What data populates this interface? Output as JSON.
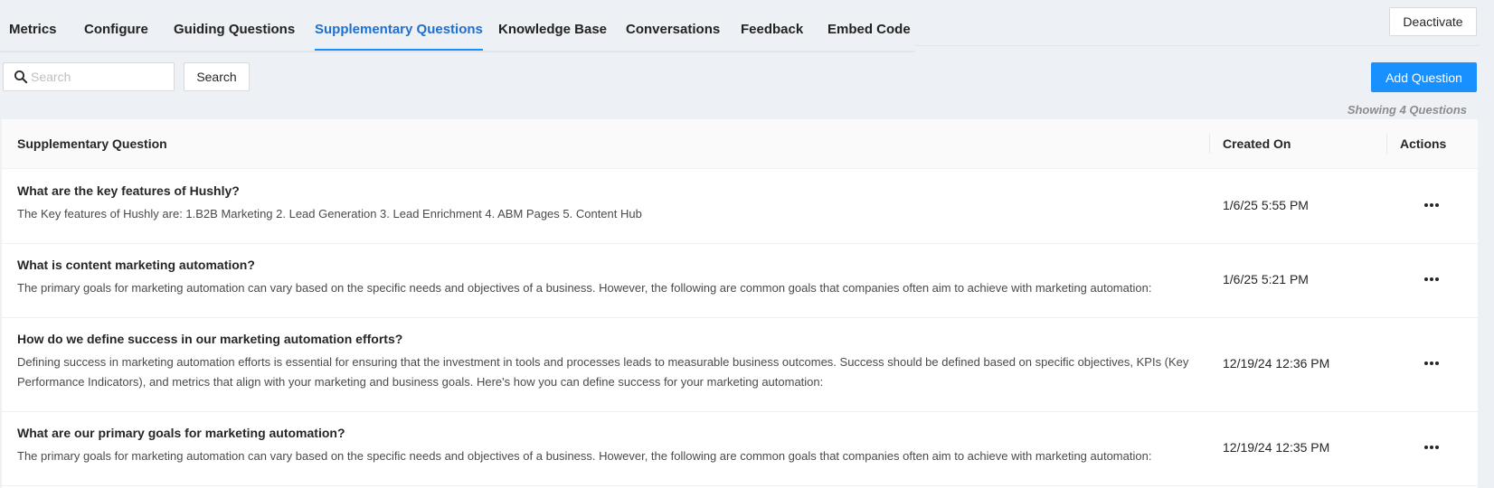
{
  "tabs": [
    {
      "label": "Metrics",
      "active": false
    },
    {
      "label": "Configure",
      "active": false
    },
    {
      "label": "Guiding Questions",
      "active": false
    },
    {
      "label": "Supplementary Questions",
      "active": true
    },
    {
      "label": "Knowledge Base",
      "active": false
    },
    {
      "label": "Conversations",
      "active": false
    },
    {
      "label": "Feedback",
      "active": false
    },
    {
      "label": "Embed Code",
      "active": false
    }
  ],
  "header": {
    "deactivate_label": "Deactivate"
  },
  "toolbar": {
    "search_placeholder": "Search",
    "search_value": "",
    "search_button_label": "Search",
    "add_button_label": "Add Question",
    "showing_text": "Showing 4 Questions"
  },
  "table": {
    "columns": {
      "question": "Supplementary Question",
      "created_on": "Created On",
      "actions": "Actions"
    },
    "rows": [
      {
        "title": "What are the key features of Hushly?",
        "answer": "The Key features of Hushly are: 1.B2B Marketing 2. Lead Generation 3. Lead Enrichment 4. ABM Pages 5. Content Hub",
        "created_on": "1/6/25 5:55 PM"
      },
      {
        "title": "What is content marketing automation?",
        "answer": "The primary goals for marketing automation can vary based on the specific needs and objectives of a business. However, the following are common goals that companies often aim to achieve with marketing automation:",
        "created_on": "1/6/25 5:21 PM"
      },
      {
        "title": "How do we define success in our marketing automation efforts?",
        "answer": "Defining success in marketing automation efforts is essential for ensuring that the investment in tools and processes leads to measurable business outcomes. Success should be defined based on specific objectives, KPIs (Key Performance Indicators), and metrics that align with your marketing and business goals. Here's how you can define success for your marketing automation:",
        "created_on": "12/19/24 12:36 PM"
      },
      {
        "title": "What are our primary goals for marketing automation?",
        "answer": "The primary goals for marketing automation can vary based on the specific needs and objectives of a business. However, the following are common goals that companies often aim to achieve with marketing automation:",
        "created_on": "12/19/24 12:35 PM"
      }
    ]
  },
  "colors": {
    "accent": "#1890ff",
    "active_tab_text": "#1f6fd1",
    "background": "#edf0f4"
  },
  "icons": {
    "search": "search-icon",
    "row_actions": "more-horizontal-icon"
  }
}
